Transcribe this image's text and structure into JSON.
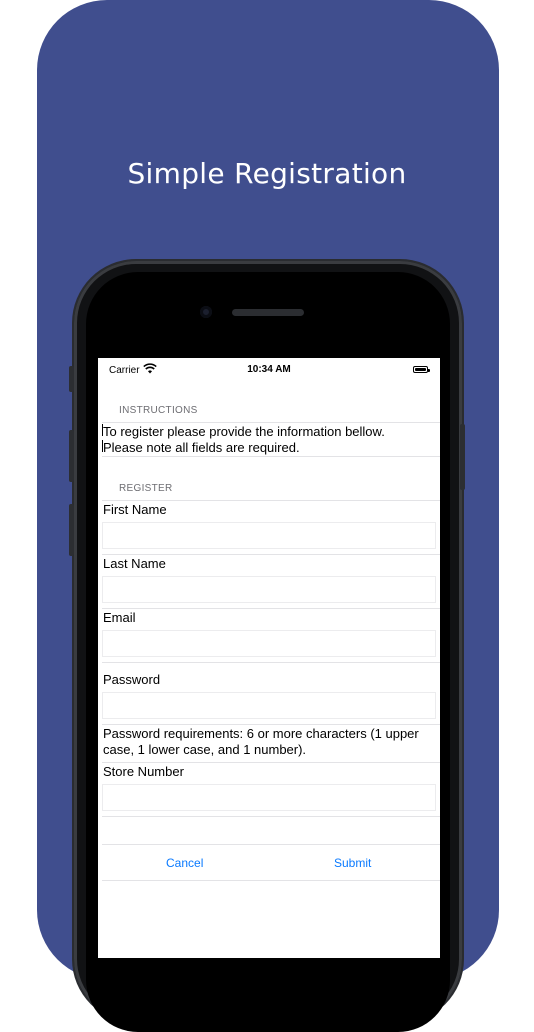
{
  "headline": "Simple Registration",
  "status_bar": {
    "carrier": "Carrier",
    "time": "10:34 AM"
  },
  "instructions": {
    "header": "INSTRUCTIONS",
    "line1": "To register please provide the information bellow.",
    "line2": "Please note all fields are required."
  },
  "register": {
    "header": "REGISTER",
    "first_name_label": "First Name",
    "first_name_value": "",
    "last_name_label": "Last Name",
    "last_name_value": "",
    "email_label": "Email",
    "email_value": "",
    "password_label": "Password",
    "password_value": "",
    "password_req_line1": "Password requirements: 6 or more characters (1 upper",
    "password_req_line2": "case, 1 lower case, and 1 number).",
    "store_number_label": "Store Number",
    "store_number_value": ""
  },
  "buttons": {
    "cancel": "Cancel",
    "submit": "Submit"
  },
  "colors": {
    "backdrop": "#404e8e",
    "accent": "#0a7aff"
  }
}
